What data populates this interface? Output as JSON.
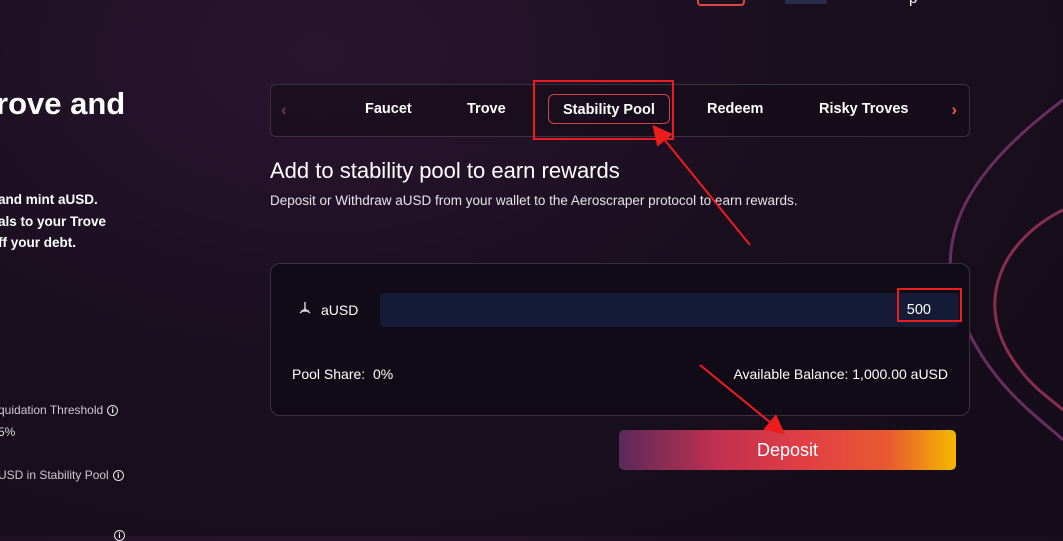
{
  "header": {
    "partial_text": "p"
  },
  "left_panel": {
    "title_partial": "rove and",
    "desc_lines": [
      " and mint aUSD.",
      "als to your Trove",
      "ff your debt."
    ],
    "stats": [
      {
        "label": "quidation Threshold",
        "value": "5%"
      },
      {
        "label": "USD in Stability Pool"
      },
      {
        "label": ""
      }
    ]
  },
  "tabs": {
    "prev": "‹",
    "next": "›",
    "items": [
      "Faucet",
      "Trove",
      "Stability Pool",
      "Redeem",
      "Risky Troves"
    ],
    "active": "Stability Pool"
  },
  "section": {
    "title": "Add to stability pool to earn rewards",
    "description": "Deposit or Withdraw aUSD from your wallet to the Aeroscraper protocol to earn rewards."
  },
  "deposit_card": {
    "token": "aUSD",
    "token_icon": "aeroscraper-icon",
    "amount_value": "500",
    "pool_share_label": "Pool Share:",
    "pool_share_value": "0%",
    "available_label": "Available Balance:",
    "available_value": "1,000.00 aUSD"
  },
  "deposit_button": {
    "label": "Deposit"
  },
  "colors": {
    "background": "#1a0f1f",
    "annotation_red": "#ee1d1d",
    "input_bg": "#151a36",
    "gradient": [
      "#5a2a5a",
      "#c43050",
      "#e85a30",
      "#f5b800"
    ]
  }
}
